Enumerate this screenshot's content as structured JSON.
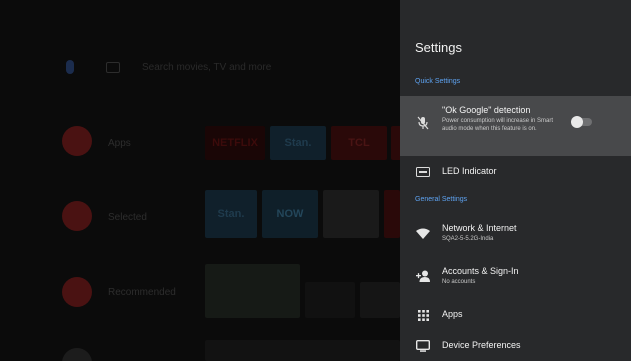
{
  "home": {
    "search_placeholder": "Search movies, TV and more",
    "rows": [
      {
        "label": "Apps",
        "icon": "apps-grid-icon",
        "color": "#4a1212"
      },
      {
        "label": "Selected",
        "icon": "tcl-icon",
        "color": "#4a1212"
      },
      {
        "label": "Recommended",
        "icon": "youtube-icon",
        "color": "#4a1212"
      }
    ],
    "tiles": {
      "netflix": "NETFLIX",
      "stan": "Stan.",
      "tcl": "TCL",
      "stan2": "Stan.",
      "now": "NOW"
    }
  },
  "settings": {
    "title": "Settings",
    "quick_settings": "Quick Settings",
    "ok_google": {
      "label": "\"Ok Google\" detection",
      "desc": "Power consumption will increase in Smart audio mode when this feature is on.",
      "enabled": false
    },
    "led": {
      "label": "LED Indicator"
    },
    "general_settings": "General Settings",
    "network": {
      "label": "Network & Internet",
      "sub": "SQA2-5-5.2G-India"
    },
    "accounts": {
      "label": "Accounts & Sign-In",
      "sub": "No accounts"
    },
    "apps": {
      "label": "Apps"
    },
    "device": {
      "label": "Device Preferences"
    },
    "accent_color": "#5ea3f2"
  }
}
